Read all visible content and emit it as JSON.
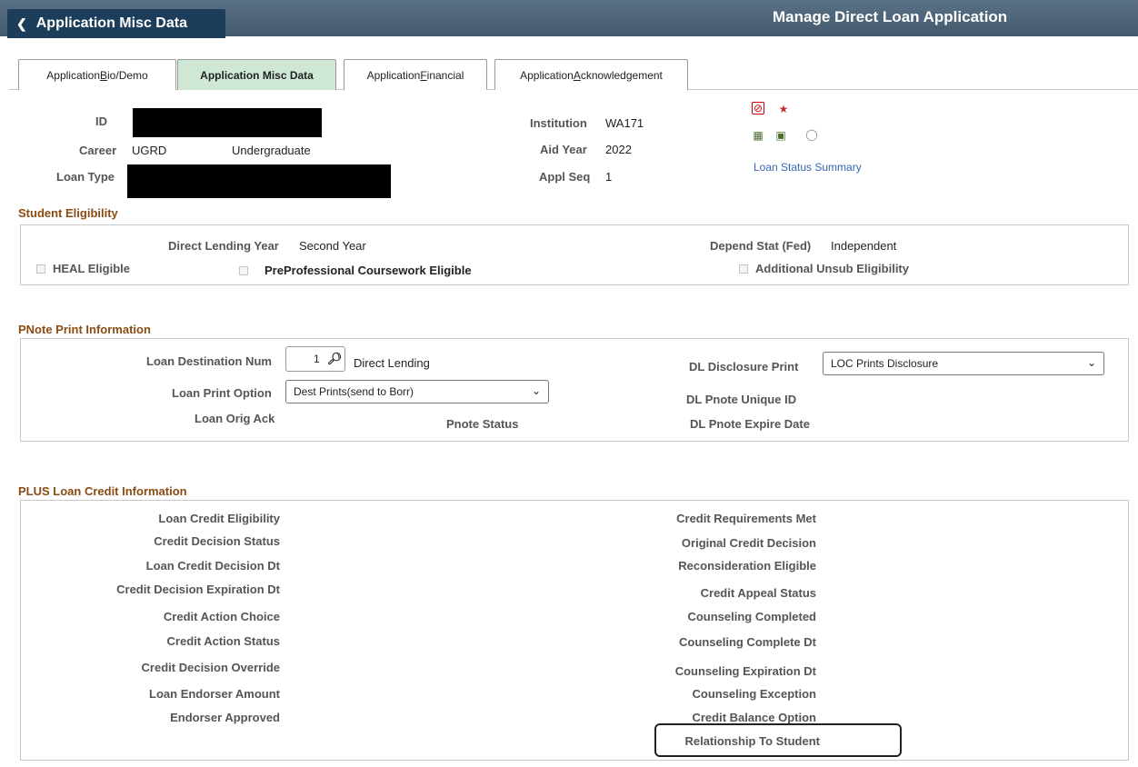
{
  "banner": {
    "back_label": "Application Misc Data",
    "page_title": "Manage Direct Loan Application"
  },
  "tabs": [
    {
      "label_pre": "Application ",
      "label_ul": "B",
      "label_post": "io/Demo",
      "active": false
    },
    {
      "label_pre": "Application Misc Data",
      "label_ul": "",
      "label_post": "",
      "active": true
    },
    {
      "label_pre": "Application ",
      "label_ul": "F",
      "label_post": "inancial",
      "active": false
    },
    {
      "label_pre": "Application ",
      "label_ul": "A",
      "label_post": "cknowledgement",
      "active": false
    }
  ],
  "header": {
    "id_label": "ID",
    "career_label": "Career",
    "career_code": "UGRD",
    "career_desc": "Undergraduate",
    "loan_type_label": "Loan Type",
    "institution_label": "Institution",
    "institution_value": "WA171",
    "aid_year_label": "Aid Year",
    "aid_year_value": "2022",
    "appl_seq_label": "Appl Seq",
    "appl_seq_value": "1",
    "loan_status_link": "Loan Status Summary"
  },
  "icons": [
    "prohibit-icon",
    "star-icon",
    "document-icon",
    "notes-icon",
    "comment-icon"
  ],
  "student_eligibility": {
    "title": "Student Eligibility",
    "direct_lending_year_label": "Direct Lending Year",
    "direct_lending_year_value": "Second Year",
    "depend_stat_label": "Depend Stat (Fed)",
    "depend_stat_value": "Independent",
    "heal_label": "HEAL Eligible",
    "preprof_label": "PreProfessional Coursework Eligible",
    "unsub_label": "Additional Unsub Eligibility"
  },
  "pnote": {
    "title": "PNote Print Information",
    "dest_num_label": "Loan Destination Num",
    "dest_num_value": "1",
    "dest_desc": "Direct Lending",
    "disclosure_label": "DL Disclosure Print",
    "disclosure_value": "LOC Prints Disclosure",
    "print_option_label": "Loan Print Option",
    "print_option_value": "Dest Prints(send to Borr)",
    "unique_id_label": "DL Pnote Unique ID",
    "orig_ack_label": "Loan Orig Ack",
    "pnote_status_label": "Pnote Status",
    "expire_label": "DL Pnote Expire Date"
  },
  "plus": {
    "title": "PLUS Loan Credit Information",
    "left": [
      "Loan Credit Eligibility",
      "Credit Decision Status",
      "Loan Credit Decision Dt",
      "Credit Decision Expiration Dt",
      "Credit Action Choice",
      "Credit Action Status",
      "Credit Decision Override",
      "Loan Endorser Amount",
      "Endorser Approved"
    ],
    "right": [
      "Credit Requirements Met",
      "Original Credit Decision",
      "Reconsideration Eligible",
      "Credit Appeal Status",
      "Counseling Completed",
      "Counseling Complete Dt",
      "Counseling Expiration Dt",
      "Counseling Exception",
      "Credit Balance Option",
      "Relationship To Student"
    ]
  }
}
